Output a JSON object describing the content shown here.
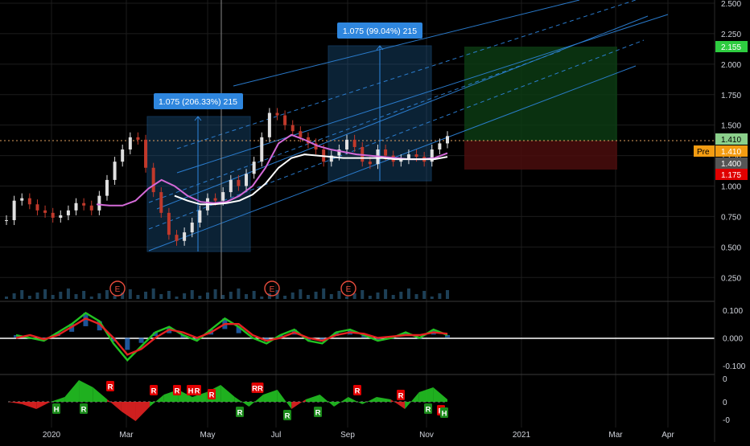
{
  "colors": {
    "background": "#000000",
    "grid": "#1c1c1c",
    "axis_text": "#d1d4dc",
    "candle_up": "#e0e0e0",
    "candle_down": "#c0392b",
    "ma_pink": "#d46ad8",
    "ma_white": "#ffffff",
    "channel": "#2e86de",
    "measure_box": "#1e5a8c",
    "measure_label": "#2e86de",
    "long_target": "#0d3d14",
    "long_stop": "#4a0d0d",
    "price_green": "#2ecc40",
    "price_pre": "#f39c12",
    "price_gray": "#555555",
    "price_red": "#e00000",
    "volume": "#2a5a7a",
    "earnings": "#e74c3c",
    "osc_green": "#22c322",
    "osc_red": "#e52222",
    "osc_blue": "#2a78d8"
  },
  "chart_data": [
    {
      "type": "candlestick",
      "pane": "price",
      "x_tick_labels": [
        "2020",
        "Mar",
        "May",
        "Jul",
        "Sep",
        "Nov",
        "2021",
        "Mar",
        "Apr"
      ],
      "y_tick_labels": [
        "2.500",
        "2.250",
        "2.000",
        "1.750",
        "1.500",
        "1.250",
        "1.000",
        "0.750",
        "0.500",
        "0.250"
      ],
      "ylim": [
        0.1,
        2.5
      ],
      "close_series": [
        0.72,
        0.88,
        0.9,
        0.85,
        0.8,
        0.78,
        0.74,
        0.76,
        0.8,
        0.86,
        0.84,
        0.8,
        0.92,
        1.05,
        1.2,
        1.3,
        1.4,
        1.38,
        1.15,
        0.95,
        0.78,
        0.6,
        0.55,
        0.62,
        0.7,
        0.8,
        0.9,
        0.88,
        0.95,
        1.05,
        1.0,
        1.1,
        1.2,
        1.4,
        1.6,
        1.58,
        1.5,
        1.45,
        1.4,
        1.35,
        1.3,
        1.2,
        1.25,
        1.3,
        1.38,
        1.32,
        1.2,
        1.18,
        1.3,
        1.25,
        1.2,
        1.22,
        1.26,
        1.24,
        1.2,
        1.3,
        1.35,
        1.41
      ],
      "moving_averages": [
        {
          "color": "#d46ad8",
          "values": [
            0.85,
            0.84,
            0.84,
            0.88,
            0.98,
            1.05,
            1.0,
            0.92,
            0.87,
            0.86,
            0.87,
            0.92,
            1.0,
            1.15,
            1.35,
            1.42,
            1.38,
            1.33,
            1.3,
            1.28,
            1.26,
            1.25,
            1.24,
            1.23,
            1.22,
            1.22,
            1.23,
            1.27
          ]
        },
        {
          "color": "#ffffff",
          "values": [
            null,
            null,
            null,
            null,
            null,
            null,
            0.92,
            0.88,
            0.85,
            0.85,
            0.86,
            0.88,
            0.93,
            1.02,
            1.15,
            1.23,
            1.26,
            1.25,
            1.24,
            1.23,
            1.23,
            1.23,
            1.23,
            1.22,
            1.22,
            1.22,
            1.22,
            1.24
          ]
        }
      ],
      "measures": [
        {
          "label": "1.075 (206.33%) 215"
        },
        {
          "label": "1.075 (99.04%) 215"
        }
      ],
      "price_labels": [
        {
          "text": "2.155",
          "color": "#2ecc40"
        },
        {
          "text": "1.410",
          "color": "#8bd08b"
        },
        {
          "text": "1.410",
          "prefix": "Pre",
          "color": "#f39c12"
        },
        {
          "text": "1.400",
          "color": "#555555"
        },
        {
          "text": "1.175",
          "color": "#e00000"
        }
      ],
      "earnings_markers": [
        "E",
        "E",
        "E"
      ]
    },
    {
      "type": "line",
      "pane": "oscillator",
      "y_tick_labels": [
        "0.100",
        "0.000",
        "-0.100"
      ],
      "ylim": [
        -0.12,
        0.12
      ],
      "series": [
        {
          "color": "#22c322",
          "values": [
            0.01,
            0.0,
            -0.01,
            0.02,
            0.05,
            0.09,
            0.06,
            -0.02,
            -0.08,
            -0.03,
            0.02,
            0.04,
            0.01,
            -0.01,
            0.03,
            0.07,
            0.04,
            0.0,
            -0.02,
            0.01,
            0.03,
            -0.01,
            -0.02,
            0.02,
            0.03,
            0.01,
            -0.01,
            0.0,
            0.02,
            0.0,
            0.03,
            0.01
          ]
        },
        {
          "color": "#e52222",
          "values": [
            0.0,
            0.01,
            -0.005,
            0.01,
            0.04,
            0.07,
            0.05,
            0.0,
            -0.06,
            -0.04,
            0.0,
            0.03,
            0.02,
            0.0,
            0.02,
            0.05,
            0.05,
            0.01,
            -0.01,
            0.0,
            0.02,
            0.0,
            -0.01,
            0.01,
            0.02,
            0.015,
            0.0,
            0.005,
            0.01,
            0.01,
            0.02,
            0.015
          ]
        }
      ]
    },
    {
      "type": "area",
      "pane": "histogram",
      "y_tick_labels": [
        "0",
        "0",
        "-0"
      ],
      "ylim": [
        -1,
        1
      ],
      "values": [
        0.0,
        -0.1,
        -0.3,
        0.0,
        0.2,
        0.9,
        0.6,
        0.1,
        -0.4,
        -0.8,
        -0.2,
        0.3,
        0.5,
        0.2,
        0.4,
        0.7,
        0.2,
        -0.2,
        0.3,
        0.5,
        -0.3,
        0.1,
        0.3,
        -0.2,
        0.2,
        -0.1,
        0.2,
        0.1,
        -0.3,
        0.4,
        0.6,
        0.1
      ],
      "signals": [
        "R",
        "H",
        "R",
        "R",
        "R",
        "H",
        "R",
        "R",
        "R",
        "RR",
        "R",
        "R",
        "R",
        "R",
        "R",
        "R",
        "H"
      ]
    }
  ]
}
